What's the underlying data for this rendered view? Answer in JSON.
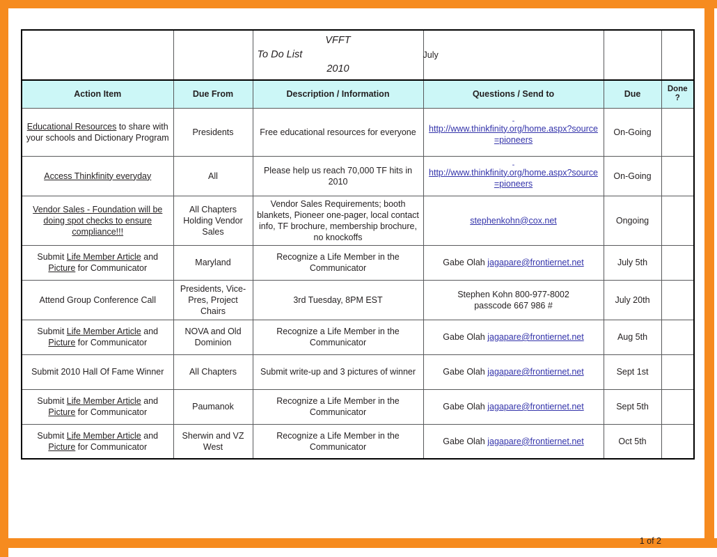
{
  "frame": {
    "accent_color": "#f68b1f"
  },
  "sheet": {
    "title_block": {
      "label_left": "To Do List",
      "org": "VFFT",
      "year": "2010",
      "month": "July"
    },
    "columns": [
      "Action Item",
      "Due From",
      "Description / Information",
      "Questions / Send to",
      "Due",
      "Done ?"
    ],
    "column_done_line1": "Done",
    "column_done_line2": "?",
    "header_fill": "#ccf7f7",
    "link_color": "#3333aa",
    "rows": [
      {
        "action_pre_underline": "Educational Resources",
        "action_rest": " to share with your schools and Dictionary Program",
        "due_from": "Presidents",
        "description": "Free educational resources for everyone",
        "questions_prefix": "",
        "questions_link": "http://www.thinkfinity.org/home.aspx?source=pioneers",
        "questions_dash": "-",
        "due": "On-Going",
        "done": ""
      },
      {
        "action_pre_underline": "Access Thinkfinity everyday",
        "action_rest": "",
        "due_from": "All",
        "description": "Please help us reach 70,000 TF hits in 2010",
        "questions_prefix": "",
        "questions_link": "http://www.thinkfinity.org/home.aspx?source=pioneers",
        "questions_dash": "-",
        "due": "On-Going",
        "done": ""
      },
      {
        "action_pre_underline": "Vendor Sales - Foundation will be doing spot checks to ensure compliance!!!",
        "action_rest": "",
        "due_from": "All Chapters Holding Vendor Sales",
        "description": "Vendor Sales Requirements; booth blankets, Pioneer one-pager, local contact info, TF brochure, membership brochure, no knockoffs",
        "questions_prefix": "",
        "questions_link": "stephenkohn@cox.net",
        "questions_dash": "",
        "due": "Ongoing",
        "done": ""
      },
      {
        "action_prefix": "Submit ",
        "action_underline": "Life Member Article",
        "action_mid": " and ",
        "action_underline2": "Picture",
        "action_suffix": " for Communicator",
        "due_from": "Maryland",
        "description": "Recognize a Life Member in the Communicator",
        "questions_prefix": "Gabe Olah ",
        "questions_link": "jagapare@frontiernet.net",
        "questions_dash": "",
        "due": "July 5th",
        "done": ""
      },
      {
        "action_plain": "Attend Group Conference Call",
        "due_from": "Presidents, Vice-Pres, Project Chairs",
        "description": "3rd Tuesday,  8PM EST",
        "description_align": "left",
        "questions_line1": "Stephen Kohn  800-977-8002",
        "questions_line2": "passcode  667 986 #",
        "questions_align": "left",
        "due": "July 20th",
        "done": ""
      },
      {
        "action_prefix": "Submit ",
        "action_underline": "Life Member Article",
        "action_mid": " and ",
        "action_underline2": "Picture",
        "action_suffix": " for Communicator",
        "due_from": "NOVA and Old Dominion",
        "description": "Recognize a Life Member in the Communicator",
        "questions_prefix": "Gabe Olah ",
        "questions_link": "jagapare@frontiernet.net",
        "questions_dash": "",
        "due": "Aug 5th",
        "done": ""
      },
      {
        "action_plain": "Submit 2010 Hall Of Fame Winner",
        "due_from": "All Chapters",
        "description": "Submit write-up and 3 pictures of winner",
        "questions_prefix": "Gabe Olah ",
        "questions_link": "jagapare@frontiernet.net",
        "questions_dash": "",
        "due": "Sept 1st",
        "done": ""
      },
      {
        "action_prefix": "Submit ",
        "action_underline": "Life Member Article",
        "action_mid": " and ",
        "action_underline2": "Picture",
        "action_suffix": " for Communicator",
        "due_from": "Paumanok",
        "description": "Recognize a Life Member in the Communicator",
        "questions_prefix": "Gabe Olah ",
        "questions_link": "jagapare@frontiernet.net",
        "questions_dash": "",
        "due": "Sept 5th",
        "done": ""
      },
      {
        "action_prefix": "Submit ",
        "action_underline": "Life Member Article",
        "action_mid": " and ",
        "action_underline2": "Picture",
        "action_suffix": " for Communicator",
        "due_from": "Sherwin and VZ West",
        "description": "Recognize a Life Member in the Communicator",
        "questions_prefix": "Gabe Olah ",
        "questions_link": "jagapare@frontiernet.net",
        "questions_dash": "",
        "due": "Oct 5th",
        "done": ""
      }
    ],
    "footer": {
      "page_indicator": "1 of 2"
    }
  }
}
